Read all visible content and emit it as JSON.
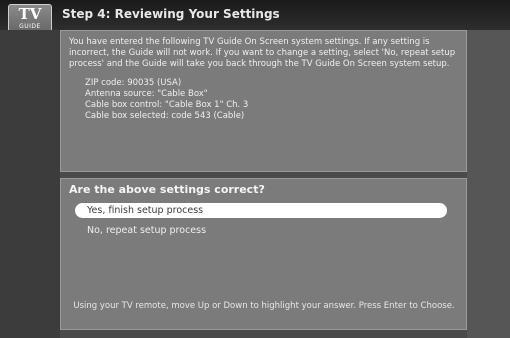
{
  "header": {
    "logo_text": "TV",
    "logo_subtext": "GUIDE",
    "title": "Step 4: Reviewing Your Settings"
  },
  "review": {
    "message": "You have entered the following TV Guide On Screen system settings. If any setting is incorrect, the Guide will not work. If you want to change a setting, select 'No, repeat setup process' and the Guide will take you back through the TV Guide On Screen system setup.",
    "settings": [
      "ZIP code: 90035 (USA)",
      "Antenna source: \"Cable Box\"",
      "Cable box control: \"Cable Box 1\" Ch. 3",
      "Cable box selected: code 543 (Cable)"
    ]
  },
  "confirm": {
    "question": "Are the above settings correct?",
    "options": [
      {
        "label": "Yes, finish setup process",
        "selected": true
      },
      {
        "label": "No, repeat setup process",
        "selected": false
      }
    ],
    "hint": "Using your TV remote, move Up or Down to highlight your answer. Press Enter to Choose."
  }
}
